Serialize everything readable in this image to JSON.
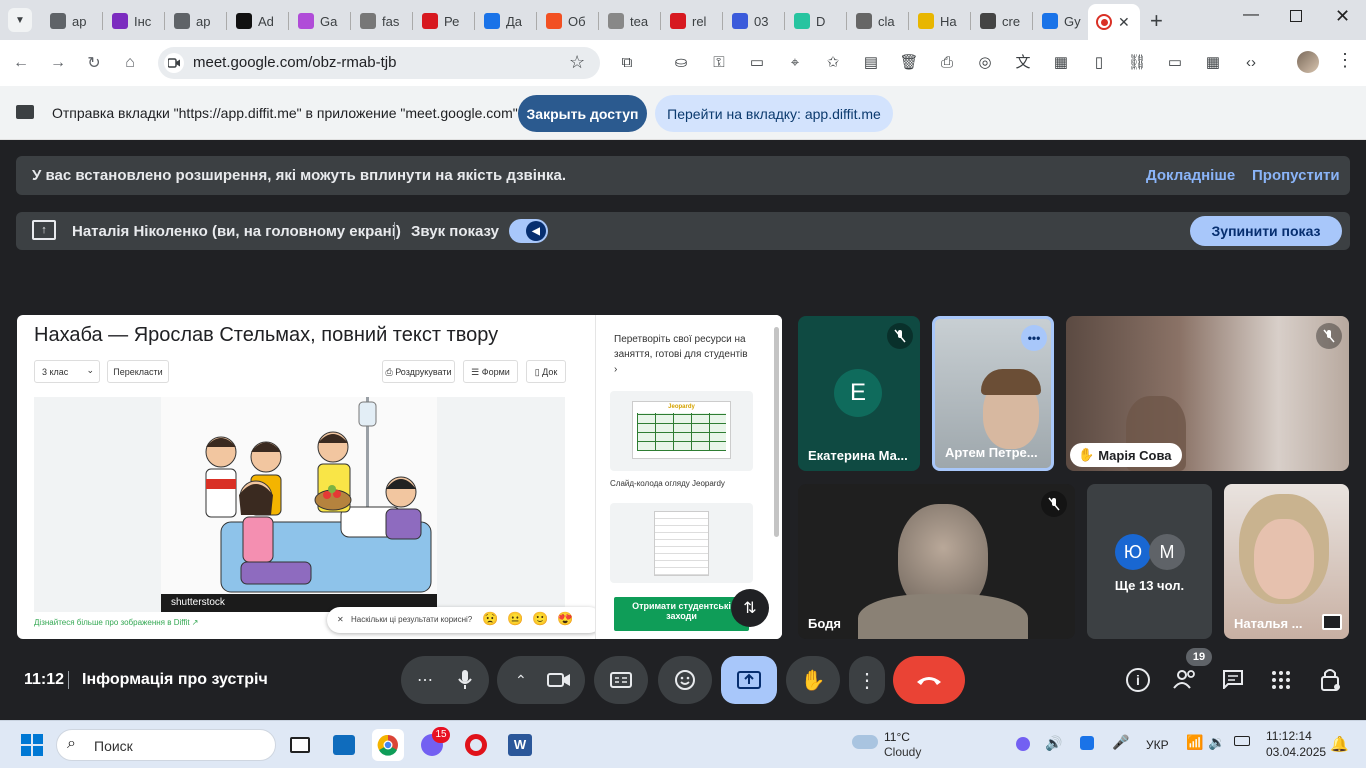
{
  "browser": {
    "tabs": [
      {
        "title": "ap",
        "color": "#5f6368"
      },
      {
        "title": "Інс",
        "color": "#7b2cbf"
      },
      {
        "title": "ap",
        "color": "#5f6368"
      },
      {
        "title": "Ad",
        "color": "#111111"
      },
      {
        "title": "Ga",
        "color": "#b04cd8"
      },
      {
        "title": "fas",
        "color": "#777777"
      },
      {
        "title": "Ре",
        "color": "#d71920"
      },
      {
        "title": "Да",
        "color": "#1a73e8"
      },
      {
        "title": "Об",
        "color": "#f25022"
      },
      {
        "title": "tea",
        "color": "#888888"
      },
      {
        "title": "rel",
        "color": "#d71920"
      },
      {
        "title": "03",
        "color": "#3b5bdb"
      },
      {
        "title": "D",
        "color": "#27c4a0"
      },
      {
        "title": "cla",
        "color": "#666666"
      },
      {
        "title": "На",
        "color": "#e8b600"
      },
      {
        "title": "cre",
        "color": "#444444"
      },
      {
        "title": "Gy",
        "color": "#1a73e8"
      }
    ],
    "url": "meet.google.com/obz-rmab-tjb"
  },
  "sharing_bar": {
    "text": "Отправка вкладки \"https://app.diffit.me\" в приложение \"meet.google.com\"...",
    "stop_button": "Закрыть доступ",
    "goto_button": "Перейти на вкладку: app.diffit.me"
  },
  "extension_banner": {
    "text": "У вас встановлено розширення, які можуть вплинути на якість дзвінка.",
    "learn_more": "Докладніше",
    "skip": "Пропустити"
  },
  "presenting_bar": {
    "presenter": "Наталія Ніколенко (ви, на головному екрані)",
    "audio_label": "Звук показу",
    "audio_on": true,
    "stop": "Зупинити показ"
  },
  "shared_screen": {
    "title": "Нахаба — Ярослав Стельмах, повний текст твору",
    "grade_select": "3 клас",
    "translate": "Перекласти",
    "print": "Роздрукувати",
    "forms": "Форми",
    "doc": "Док",
    "image_caption": "Дізнайтеся більше про зображення в Diffit",
    "watermark": "shutterstock",
    "feedback_question": "Наскільки ці результати корисні?",
    "sidebar_text": "Перетворіть свої ресурси на заняття, готові для студентів",
    "jeopardy_title": "Jeopardy",
    "card1_label": "Слайд-колода огляду Jeopardy",
    "student_button": "Отримати студентські заходи"
  },
  "participants": [
    {
      "name": "Екатерина Ма...",
      "initial": "E",
      "bg": "#0f6b5c",
      "muted": true
    },
    {
      "name": "Артем Петре...",
      "bg": "#aab3b8",
      "speaking": true
    },
    {
      "name": "Марія Сова",
      "bg": "#8a7266",
      "muted": true,
      "hand": true
    },
    {
      "name": "Бодя",
      "bg": "#1f1f1f",
      "muted": true
    },
    {
      "name": "Ще 13 чол.",
      "initials": [
        "Ю",
        "М"
      ],
      "bg": "#3c4043"
    },
    {
      "name": "Наталья ...",
      "bg": "#c8b0a3"
    }
  ],
  "controls": {
    "time": "11:12",
    "meeting_info": "Інформація про зустріч",
    "participant_count": "19"
  },
  "taskbar": {
    "search": "Поиск",
    "weather_temp": "11°C",
    "weather_desc": "Cloudy",
    "lang": "УКР",
    "time": "11:12:14",
    "date": "03.04.2025",
    "viber_badge": "15"
  },
  "colors": {
    "accent_blue": "#a8c7fa",
    "dark_button": "#3c4043",
    "end_call": "#ea4335",
    "present_active": "#a8c7fa"
  }
}
